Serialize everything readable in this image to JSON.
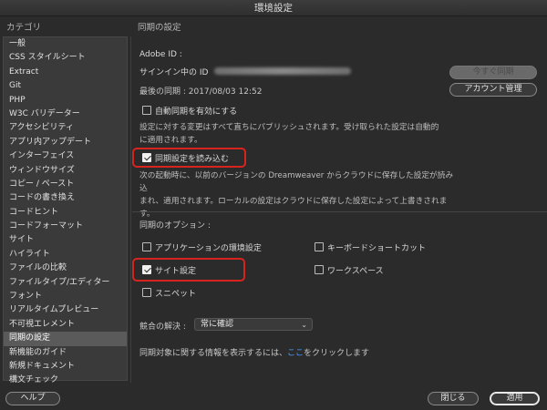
{
  "window": {
    "title": "環境設定"
  },
  "sidebar": {
    "header": "カテゴリ",
    "items": [
      {
        "label": "一般"
      },
      {
        "label": "CSS スタイルシート"
      },
      {
        "label": "Extract"
      },
      {
        "label": "Git"
      },
      {
        "label": "PHP"
      },
      {
        "label": "W3C バリデーター"
      },
      {
        "label": "アクセシビリティ"
      },
      {
        "label": "アプリ内アップデート"
      },
      {
        "label": "インターフェイス"
      },
      {
        "label": "ウィンドウサイズ"
      },
      {
        "label": "コピー / ペースト"
      },
      {
        "label": "コードの書き換え"
      },
      {
        "label": "コードヒント"
      },
      {
        "label": "コードフォーマット"
      },
      {
        "label": "サイト"
      },
      {
        "label": "ハイライト"
      },
      {
        "label": "ファイルの比較"
      },
      {
        "label": "ファイルタイプ/エディター"
      },
      {
        "label": "フォント"
      },
      {
        "label": "リアルタイムプレビュー"
      },
      {
        "label": "不可視エレメント"
      },
      {
        "label": "同期の設定",
        "active": true
      },
      {
        "label": "新機能のガイド"
      },
      {
        "label": "新規ドキュメント"
      },
      {
        "label": "構文チェック"
      }
    ]
  },
  "main": {
    "header": "同期の設定",
    "adobe_id_label": "Adobe ID :",
    "signin_label": "サインイン中の ID",
    "last_sync": "最後の同期 : 2017/08/03 12:52",
    "sync_now_button": "今すぐ同期",
    "account_button": "アカウント管理",
    "auto_sync_label": "自動同期を有効にする",
    "auto_sync_desc_1": "設定に対する変更はすべて直ちにパブリッシュされます。受け取られた設定は自動的",
    "auto_sync_desc_2": "に適用されます。",
    "import_label": "同期設定を読み込む",
    "import_desc_1": "次の起動時に、以前のバージョンの Dreamweaver からクラウドに保存した設定が読み込",
    "import_desc_2": "まれ、適用されます。ローカルの設定はクラウドに保存した設定によって上書きされま",
    "import_desc_3": "す。",
    "options_header": "同期のオプション :",
    "options": {
      "app_prefs": "アプリケーションの環境設定",
      "keyboard": "キーボードショートカット",
      "site": "サイト設定",
      "workspace": "ワークスペース",
      "snippets": "スニペット"
    },
    "conflict_label": "競合の解決 :",
    "conflict_value": "常に確認",
    "info_prefix": "同期対象に関する情報を表示するには、",
    "info_link": "ここ",
    "info_suffix": "をクリックします"
  },
  "footer": {
    "help": "ヘルプ",
    "close": "閉じる",
    "apply": "適用"
  },
  "colors": {
    "highlight": "#d8241f",
    "link": "#4a9eff",
    "background": "#2b2b2b"
  }
}
